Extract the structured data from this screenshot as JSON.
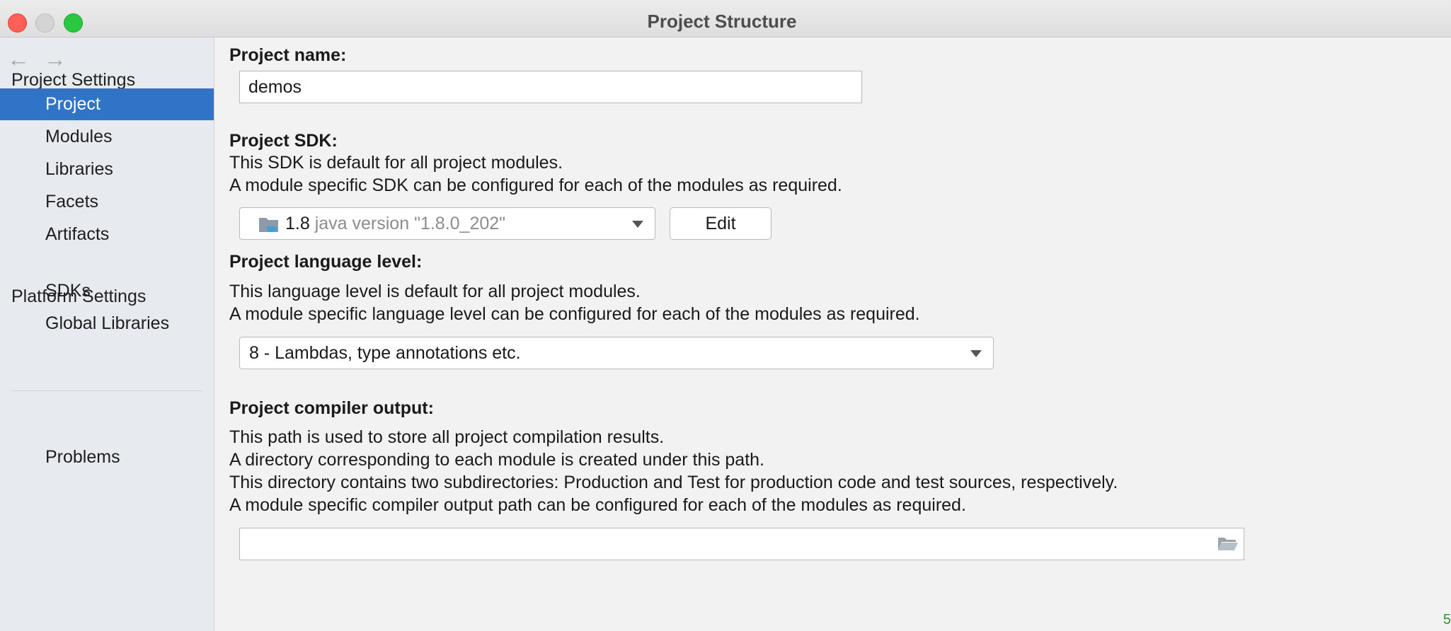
{
  "window": {
    "title": "Project Structure"
  },
  "sidebar": {
    "back_icon": "arrow-left-icon",
    "forward_icon": "arrow-right-icon",
    "project_settings_header": "Project Settings",
    "project_settings_items": [
      "Project",
      "Modules",
      "Libraries",
      "Facets",
      "Artifacts"
    ],
    "selected_item": "Project",
    "platform_settings_header": "Platform Settings",
    "platform_settings_items": [
      "SDKs",
      "Global Libraries"
    ],
    "problems_label": "Problems"
  },
  "main": {
    "project_name": {
      "label": "Project name:",
      "value": "demos"
    },
    "sdk": {
      "label": "Project SDK:",
      "desc_line1": "This SDK is default for all project modules.",
      "desc_line2": "A module specific SDK can be configured for each of the modules as required.",
      "selected_version": "1.8",
      "selected_detail": "java version \"1.8.0_202\"",
      "icon": "sdk-folder-icon",
      "edit_label": "Edit"
    },
    "language_level": {
      "label": "Project language level:",
      "desc_line1": "This language level is default for all project modules.",
      "desc_line2": "A module specific language level can be configured for each of the modules as required.",
      "selected": "8 - Lambdas, type annotations etc."
    },
    "compiler_output": {
      "label": "Project compiler output:",
      "desc_line1": "This path is used to store all project compilation results.",
      "desc_line2": "A directory corresponding to each module is created under this path.",
      "desc_line3": "This directory contains two subdirectories: Production and Test for production code and test sources, respectively.",
      "desc_line4": "A module specific compiler output path can be configured for each of the modules as required.",
      "path_value": "",
      "browse_icon": "folder-open-icon"
    }
  },
  "colors": {
    "selection": "#2f74c6",
    "close": "#fe5f57",
    "maximize": "#2ac840"
  }
}
